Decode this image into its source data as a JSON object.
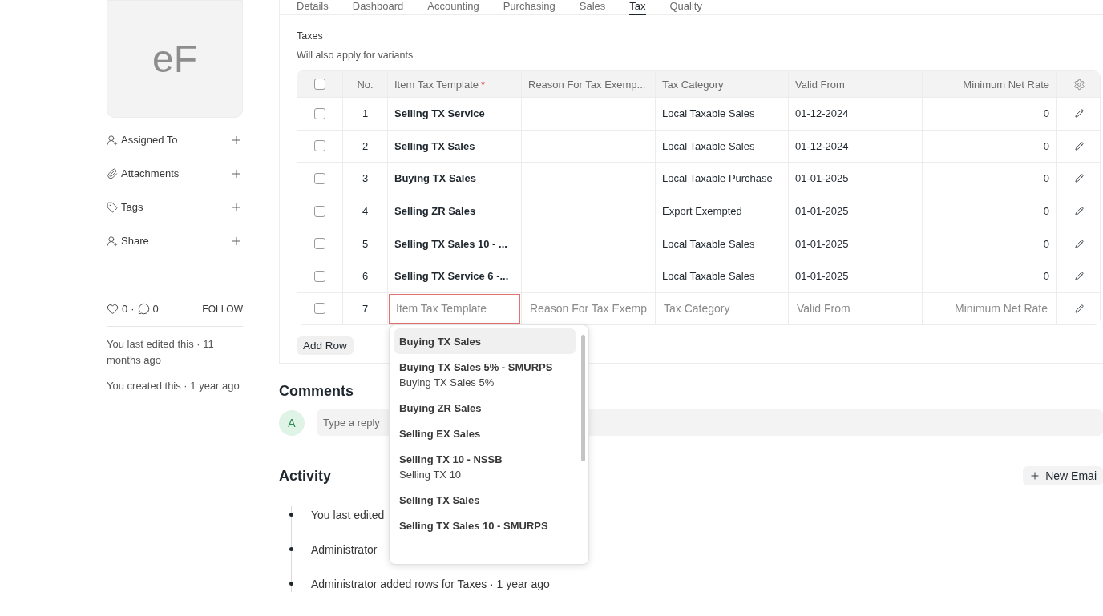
{
  "sidebar": {
    "avatar_initials": "eF",
    "items": [
      {
        "label": "Assigned To",
        "kind": "assign"
      },
      {
        "label": "Attachments",
        "kind": "attach"
      },
      {
        "label": "Tags",
        "kind": "tag"
      },
      {
        "label": "Share",
        "kind": "share"
      }
    ],
    "likes": "0",
    "separator": "·",
    "comments": "0",
    "follow": "FOLLOW",
    "notes": [
      "You last edited this · 11 months ago",
      "You created this · 1 year ago"
    ]
  },
  "tabs": [
    {
      "label": "Details",
      "selected": false
    },
    {
      "label": "Dashboard",
      "selected": false
    },
    {
      "label": "Accounting",
      "selected": false
    },
    {
      "label": "Purchasing",
      "selected": false
    },
    {
      "label": "Sales",
      "selected": false
    },
    {
      "label": "Tax",
      "selected": true
    },
    {
      "label": "Quality",
      "selected": false
    }
  ],
  "section": {
    "label": "Taxes",
    "description": "Will also apply for variants"
  },
  "table": {
    "all_checked": false,
    "columns": [
      {
        "label": "No."
      },
      {
        "label": "Item Tax Template",
        "required_mark": "*"
      },
      {
        "label": "Reason For Tax Exemp..."
      },
      {
        "label": "Tax Category"
      },
      {
        "label": "Valid From"
      },
      {
        "label": "Minimum Net Rate"
      }
    ],
    "rows": [
      {
        "checked": false,
        "no": "1",
        "template": "Selling TX Service",
        "reason": "",
        "category": "Local Taxable Sales",
        "valid_from": "01-12-2024",
        "min_rate": "0"
      },
      {
        "checked": false,
        "no": "2",
        "template": "Selling TX Sales",
        "reason": "",
        "category": "Local Taxable Sales",
        "valid_from": "01-12-2024",
        "min_rate": "0"
      },
      {
        "checked": false,
        "no": "3",
        "template": "Buying TX Sales",
        "reason": "",
        "category": "Local Taxable Purchase",
        "valid_from": "01-01-2025",
        "min_rate": "0"
      },
      {
        "checked": false,
        "no": "4",
        "template": "Selling ZR Sales",
        "reason": "",
        "category": "Export Exempted",
        "valid_from": "01-01-2025",
        "min_rate": "0"
      },
      {
        "checked": false,
        "no": "5",
        "template": "Selling TX Sales 10 - ...",
        "reason": "",
        "category": "Local Taxable Sales",
        "valid_from": "01-01-2025",
        "min_rate": "0"
      },
      {
        "checked": false,
        "no": "6",
        "template": "Selling TX Service 6 -...",
        "reason": "",
        "category": "Local Taxable Sales",
        "valid_from": "01-01-2025",
        "min_rate": "0"
      }
    ],
    "new_row": {
      "checked": false,
      "no": "7",
      "fields": [
        {
          "placeholder": "Item Tax Template",
          "focused": true
        },
        {
          "placeholder": "Reason For Tax Exemp",
          "focused": false
        },
        {
          "placeholder": "Tax Category",
          "focused": false
        },
        {
          "placeholder": "Valid From",
          "focused": false
        },
        {
          "placeholder": "Minimum Net Rate",
          "focused": false
        }
      ]
    },
    "add_row": "Add Row"
  },
  "dropdown": [
    {
      "title": "Buying TX Sales",
      "highlighted": true
    },
    {
      "title": "Buying TX Sales 5% - SMURPS",
      "description": "Buying TX Sales 5%",
      "highlighted": false
    },
    {
      "title": "Buying ZR Sales",
      "highlighted": false
    },
    {
      "title": "Selling EX Sales",
      "highlighted": false
    },
    {
      "title": "Selling TX 10 - NSSB",
      "description": "Selling TX 10",
      "highlighted": false
    },
    {
      "title": "Selling TX Sales",
      "highlighted": false
    },
    {
      "title": "Selling TX Sales 10 - SMURPS",
      "highlighted": false
    }
  ],
  "comments": {
    "title": "Comments",
    "avatar": "A",
    "placeholder": "Type a reply"
  },
  "activity": {
    "title": "Activity",
    "new_email": "New Emai",
    "items": [
      "You last edited",
      "Administrator",
      "Administrator added rows for Taxes · 1 year ago"
    ]
  }
}
